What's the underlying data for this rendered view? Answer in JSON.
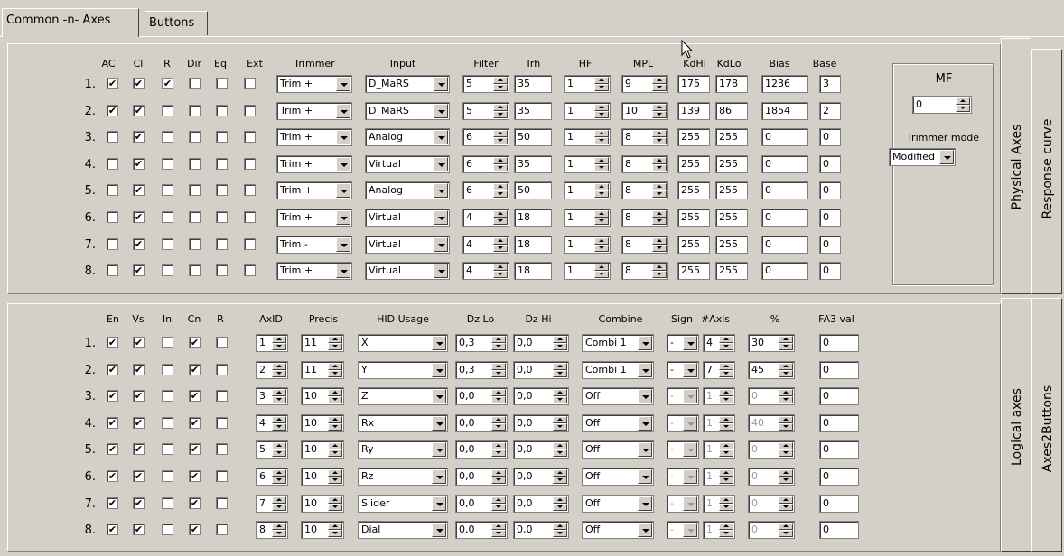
{
  "tabs": [
    {
      "label": "Common -n- Axes",
      "active": true
    },
    {
      "label": "Buttons",
      "active": false
    }
  ],
  "side_tabs": {
    "physical_axes": "Physical Axes",
    "response_curve": "Response curve",
    "logical_axes": "Logical axes",
    "axes2buttons": "Axes2Buttons"
  },
  "physical": {
    "headers": {
      "ac": "AC",
      "cl": "Cl",
      "r": "R",
      "dir": "Dir",
      "eq": "Eq",
      "ext": "Ext",
      "trimmer": "Trimmer",
      "input": "Input",
      "filter": "Filter",
      "trh": "Trh",
      "hf": "HF",
      "mpl": "MPL",
      "kdhi": "KdHi",
      "kdlo": "KdLo",
      "bias": "Bias",
      "base": "Base"
    },
    "rows": [
      {
        "no": "1.",
        "ac": true,
        "cl": true,
        "r": true,
        "dir": false,
        "eq": false,
        "ext": false,
        "trimmer": "Trim +",
        "input": "D_MaRS",
        "filter": "5",
        "trh": "35",
        "hf": "1",
        "mpl": "9",
        "kdhi": "175",
        "kdlo": "178",
        "bias": "1236",
        "base": "3"
      },
      {
        "no": "2.",
        "ac": true,
        "cl": true,
        "r": false,
        "dir": false,
        "eq": false,
        "ext": false,
        "trimmer": "Trim +",
        "input": "D_MaRS",
        "filter": "5",
        "trh": "35",
        "hf": "1",
        "mpl": "10",
        "kdhi": "139",
        "kdlo": "86",
        "bias": "1854",
        "base": "2"
      },
      {
        "no": "3.",
        "ac": false,
        "cl": true,
        "r": false,
        "dir": false,
        "eq": false,
        "ext": false,
        "trimmer": "Trim +",
        "input": "Analog",
        "filter": "6",
        "trh": "50",
        "hf": "1",
        "mpl": "8",
        "kdhi": "255",
        "kdlo": "255",
        "bias": "0",
        "base": "0"
      },
      {
        "no": "4.",
        "ac": false,
        "cl": true,
        "r": false,
        "dir": false,
        "eq": false,
        "ext": false,
        "trimmer": "Trim +",
        "input": "Virtual",
        "filter": "6",
        "trh": "35",
        "hf": "1",
        "mpl": "8",
        "kdhi": "255",
        "kdlo": "255",
        "bias": "0",
        "base": "0"
      },
      {
        "no": "5.",
        "ac": false,
        "cl": true,
        "r": false,
        "dir": false,
        "eq": false,
        "ext": false,
        "trimmer": "Trim +",
        "input": "Analog",
        "filter": "6",
        "trh": "50",
        "hf": "1",
        "mpl": "8",
        "kdhi": "255",
        "kdlo": "255",
        "bias": "0",
        "base": "0"
      },
      {
        "no": "6.",
        "ac": false,
        "cl": true,
        "r": false,
        "dir": false,
        "eq": false,
        "ext": false,
        "trimmer": "Trim +",
        "input": "Virtual",
        "filter": "4",
        "trh": "18",
        "hf": "1",
        "mpl": "8",
        "kdhi": "255",
        "kdlo": "255",
        "bias": "0",
        "base": "0"
      },
      {
        "no": "7.",
        "ac": false,
        "cl": true,
        "r": false,
        "dir": false,
        "eq": false,
        "ext": false,
        "trimmer": "Trim -",
        "input": "Virtual",
        "filter": "4",
        "trh": "18",
        "hf": "1",
        "mpl": "8",
        "kdhi": "255",
        "kdlo": "255",
        "bias": "0",
        "base": "0"
      },
      {
        "no": "8.",
        "ac": false,
        "cl": true,
        "r": false,
        "dir": false,
        "eq": false,
        "ext": false,
        "trimmer": "Trim +",
        "input": "Virtual",
        "filter": "4",
        "trh": "18",
        "hf": "1",
        "mpl": "8",
        "kdhi": "255",
        "kdlo": "255",
        "bias": "0",
        "base": "0"
      }
    ],
    "mf": {
      "label": "MF",
      "value": "0",
      "trimmer_mode_label": "Trimmer mode",
      "trimmer_mode": "Modified"
    }
  },
  "logical": {
    "headers": {
      "en": "En",
      "vs": "Vs",
      "in": "In",
      "cn": "Cn",
      "r": "R",
      "axid": "AxID",
      "precis": "Precis",
      "hid": "HID Usage",
      "dzlo": "Dz Lo",
      "dzhi": "Dz Hi",
      "combine": "Combine",
      "sign": "Sign",
      "naxis": "#Axis",
      "pct": "%",
      "fa3": "FA3 val"
    },
    "rows": [
      {
        "no": "1.",
        "en": true,
        "vs": true,
        "in": false,
        "cn": true,
        "r": false,
        "axid": "1",
        "precis": "11",
        "hid": "X",
        "dzlo": "0,3",
        "dzhi": "0,0",
        "combine": "Combi 1",
        "sign": "-",
        "naxis": "4",
        "pct": "30",
        "fa3": "0",
        "active": true
      },
      {
        "no": "2.",
        "en": true,
        "vs": true,
        "in": false,
        "cn": true,
        "r": false,
        "axid": "2",
        "precis": "11",
        "hid": "Y",
        "dzlo": "0,3",
        "dzhi": "0,0",
        "combine": "Combi 1",
        "sign": "-",
        "naxis": "7",
        "pct": "45",
        "fa3": "0",
        "active": true
      },
      {
        "no": "3.",
        "en": true,
        "vs": true,
        "in": false,
        "cn": true,
        "r": false,
        "axid": "3",
        "precis": "10",
        "hid": "Z",
        "dzlo": "0,0",
        "dzhi": "0,0",
        "combine": "Off",
        "sign": "-",
        "naxis": "1",
        "pct": "0",
        "fa3": "0",
        "active": false
      },
      {
        "no": "4.",
        "en": true,
        "vs": true,
        "in": false,
        "cn": true,
        "r": false,
        "axid": "4",
        "precis": "10",
        "hid": "Rx",
        "dzlo": "0,0",
        "dzhi": "0,0",
        "combine": "Off",
        "sign": "-",
        "naxis": "1",
        "pct": "40",
        "fa3": "0",
        "active": false
      },
      {
        "no": "5.",
        "en": true,
        "vs": true,
        "in": false,
        "cn": true,
        "r": false,
        "axid": "5",
        "precis": "10",
        "hid": "Ry",
        "dzlo": "0,0",
        "dzhi": "0,0",
        "combine": "Off",
        "sign": "-",
        "naxis": "1",
        "pct": "0",
        "fa3": "0",
        "active": false
      },
      {
        "no": "6.",
        "en": true,
        "vs": true,
        "in": false,
        "cn": true,
        "r": false,
        "axid": "6",
        "precis": "10",
        "hid": "Rz",
        "dzlo": "0,0",
        "dzhi": "0,0",
        "combine": "Off",
        "sign": "-",
        "naxis": "1",
        "pct": "0",
        "fa3": "0",
        "active": false
      },
      {
        "no": "7.",
        "en": true,
        "vs": true,
        "in": false,
        "cn": true,
        "r": false,
        "axid": "7",
        "precis": "10",
        "hid": "Slider",
        "dzlo": "0,0",
        "dzhi": "0,0",
        "combine": "Off",
        "sign": "-",
        "naxis": "1",
        "pct": "0",
        "fa3": "0",
        "active": false
      },
      {
        "no": "8.",
        "en": true,
        "vs": true,
        "in": false,
        "cn": true,
        "r": false,
        "axid": "8",
        "precis": "10",
        "hid": "Dial",
        "dzlo": "0,0",
        "dzhi": "0,0",
        "combine": "Off",
        "sign": "-",
        "naxis": "1",
        "pct": "0",
        "fa3": "0",
        "active": false
      }
    ]
  }
}
